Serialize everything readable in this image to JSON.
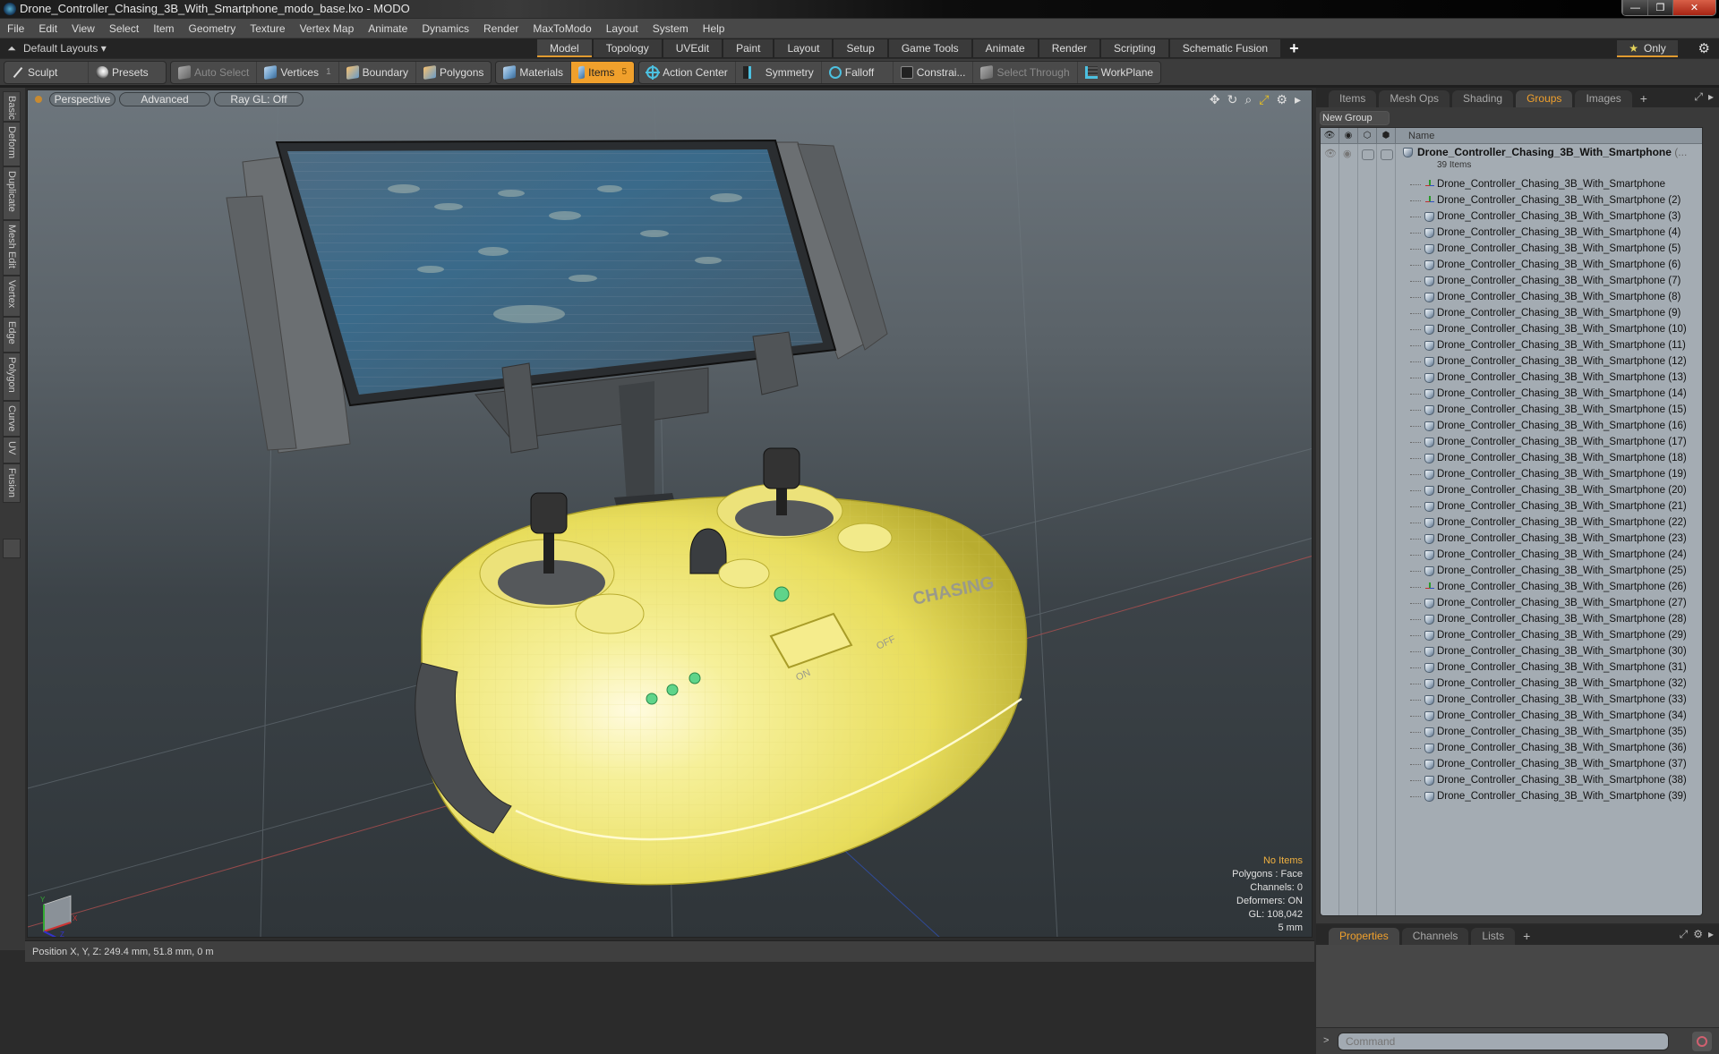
{
  "window": {
    "title": "Drone_Controller_Chasing_3B_With_Smartphone_modo_base.lxo - MODO",
    "controls": {
      "minimize": "—",
      "maximize": "❐",
      "close": "✕"
    }
  },
  "menu": [
    "File",
    "Edit",
    "View",
    "Select",
    "Item",
    "Geometry",
    "Texture",
    "Vertex Map",
    "Animate",
    "Dynamics",
    "Render",
    "MaxToModo",
    "Layout",
    "System",
    "Help"
  ],
  "layout_bar": {
    "layouts_label": "Default Layouts ▾",
    "tabs": [
      {
        "label": "Model",
        "active": true
      },
      {
        "label": "Topology"
      },
      {
        "label": "UVEdit"
      },
      {
        "label": "Paint"
      },
      {
        "label": "Layout"
      },
      {
        "label": "Setup"
      },
      {
        "label": "Game Tools"
      },
      {
        "label": "Animate"
      },
      {
        "label": "Render"
      },
      {
        "label": "Scripting"
      },
      {
        "label": "Schematic Fusion"
      }
    ],
    "add_tab": "+",
    "only_label": "Only",
    "star": "★",
    "gear": "⚙"
  },
  "toolbar": {
    "sculpt": "Sculpt",
    "presets": "Presets",
    "auto_select": "Auto Select",
    "vertices": "Vertices",
    "vertices_count": "1",
    "boundary": "Boundary",
    "polygons": "Polygons",
    "materials": "Materials",
    "items": "Items",
    "items_count": "5",
    "action_center": "Action Center",
    "symmetry": "Symmetry",
    "falloff": "Falloff",
    "constraints": "Constrai...",
    "select_through": "Select Through",
    "workplane": "WorkPlane"
  },
  "left_tabs": [
    "Basic",
    "Deform",
    "Duplicate",
    "Mesh Edit",
    "Vertex",
    "Edge",
    "Polygon",
    "Curve",
    "UV",
    "Fusion"
  ],
  "viewport": {
    "view_mode": "Perspective",
    "shading": "Advanced",
    "raygl": "Ray GL: Off",
    "icons": {
      "move": "✥",
      "rotate": "↻",
      "zoom": "⌕",
      "maximize": "⤢",
      "settings": "⚙",
      "more": "▸"
    },
    "stats": {
      "selection": "No Items",
      "polygons": "Polygons : Face",
      "channels": "Channels: 0",
      "deformers": "Deformers: ON",
      "gl": "GL: 108,042",
      "grid": "5 mm"
    },
    "model_text": {
      "brand": "CHASING",
      "on": "ON",
      "off": "OFF"
    },
    "axis": {
      "x": "X",
      "y": "Y",
      "z": "Z"
    }
  },
  "status": {
    "position": "Position X, Y, Z:   249.4 mm, 51.8 mm, 0 m"
  },
  "right_panel": {
    "tabs": [
      {
        "label": "Items"
      },
      {
        "label": "Mesh Ops"
      },
      {
        "label": "Shading"
      },
      {
        "label": "Groups",
        "active": true
      },
      {
        "label": "Images"
      }
    ],
    "add_tab": "+",
    "new_group": "New Group",
    "columns": {
      "name": "Name"
    },
    "root_group": {
      "name": "Drone_Controller_Chasing_3B_With_Smartphone",
      "more": "(...",
      "count": "39 Items"
    },
    "items": [
      {
        "name": "Drone_Controller_Chasing_3B_With_Smartphone",
        "type": "locator"
      },
      {
        "name": "Drone_Controller_Chasing_3B_With_Smartphone (2)",
        "type": "locator"
      },
      {
        "name": "Drone_Controller_Chasing_3B_With_Smartphone (3)",
        "type": "mesh"
      },
      {
        "name": "Drone_Controller_Chasing_3B_With_Smartphone (4)",
        "type": "mesh"
      },
      {
        "name": "Drone_Controller_Chasing_3B_With_Smartphone (5)",
        "type": "mesh"
      },
      {
        "name": "Drone_Controller_Chasing_3B_With_Smartphone (6)",
        "type": "mesh"
      },
      {
        "name": "Drone_Controller_Chasing_3B_With_Smartphone (7)",
        "type": "mesh"
      },
      {
        "name": "Drone_Controller_Chasing_3B_With_Smartphone (8)",
        "type": "mesh"
      },
      {
        "name": "Drone_Controller_Chasing_3B_With_Smartphone (9)",
        "type": "mesh"
      },
      {
        "name": "Drone_Controller_Chasing_3B_With_Smartphone (10)",
        "type": "mesh"
      },
      {
        "name": "Drone_Controller_Chasing_3B_With_Smartphone (11)",
        "type": "mesh"
      },
      {
        "name": "Drone_Controller_Chasing_3B_With_Smartphone (12)",
        "type": "mesh"
      },
      {
        "name": "Drone_Controller_Chasing_3B_With_Smartphone (13)",
        "type": "mesh"
      },
      {
        "name": "Drone_Controller_Chasing_3B_With_Smartphone (14)",
        "type": "mesh"
      },
      {
        "name": "Drone_Controller_Chasing_3B_With_Smartphone (15)",
        "type": "mesh"
      },
      {
        "name": "Drone_Controller_Chasing_3B_With_Smartphone (16)",
        "type": "mesh"
      },
      {
        "name": "Drone_Controller_Chasing_3B_With_Smartphone (17)",
        "type": "mesh"
      },
      {
        "name": "Drone_Controller_Chasing_3B_With_Smartphone (18)",
        "type": "mesh"
      },
      {
        "name": "Drone_Controller_Chasing_3B_With_Smartphone (19)",
        "type": "mesh"
      },
      {
        "name": "Drone_Controller_Chasing_3B_With_Smartphone (20)",
        "type": "mesh"
      },
      {
        "name": "Drone_Controller_Chasing_3B_With_Smartphone (21)",
        "type": "mesh"
      },
      {
        "name": "Drone_Controller_Chasing_3B_With_Smartphone (22)",
        "type": "mesh"
      },
      {
        "name": "Drone_Controller_Chasing_3B_With_Smartphone (23)",
        "type": "mesh"
      },
      {
        "name": "Drone_Controller_Chasing_3B_With_Smartphone (24)",
        "type": "mesh"
      },
      {
        "name": "Drone_Controller_Chasing_3B_With_Smartphone (25)",
        "type": "mesh"
      },
      {
        "name": "Drone_Controller_Chasing_3B_With_Smartphone (26)",
        "type": "locator"
      },
      {
        "name": "Drone_Controller_Chasing_3B_With_Smartphone (27)",
        "type": "mesh"
      },
      {
        "name": "Drone_Controller_Chasing_3B_With_Smartphone (28)",
        "type": "mesh"
      },
      {
        "name": "Drone_Controller_Chasing_3B_With_Smartphone (29)",
        "type": "mesh"
      },
      {
        "name": "Drone_Controller_Chasing_3B_With_Smartphone (30)",
        "type": "mesh"
      },
      {
        "name": "Drone_Controller_Chasing_3B_With_Smartphone (31)",
        "type": "mesh"
      },
      {
        "name": "Drone_Controller_Chasing_3B_With_Smartphone (32)",
        "type": "mesh"
      },
      {
        "name": "Drone_Controller_Chasing_3B_With_Smartphone (33)",
        "type": "mesh"
      },
      {
        "name": "Drone_Controller_Chasing_3B_With_Smartphone (34)",
        "type": "mesh"
      },
      {
        "name": "Drone_Controller_Chasing_3B_With_Smartphone (35)",
        "type": "mesh"
      },
      {
        "name": "Drone_Controller_Chasing_3B_With_Smartphone (36)",
        "type": "mesh"
      },
      {
        "name": "Drone_Controller_Chasing_3B_With_Smartphone (37)",
        "type": "mesh"
      },
      {
        "name": "Drone_Controller_Chasing_3B_With_Smartphone (38)",
        "type": "mesh"
      },
      {
        "name": "Drone_Controller_Chasing_3B_With_Smartphone (39)",
        "type": "mesh"
      }
    ],
    "bottom_tabs": [
      {
        "label": "Properties",
        "active": true
      },
      {
        "label": "Channels"
      },
      {
        "label": "Lists"
      }
    ],
    "command_placeholder": "Command",
    "command_prompt": ">"
  },
  "colors": {
    "accent": "#f0a02c",
    "model_yellow": "#f2ec86",
    "led_green": "#5fd48a"
  }
}
